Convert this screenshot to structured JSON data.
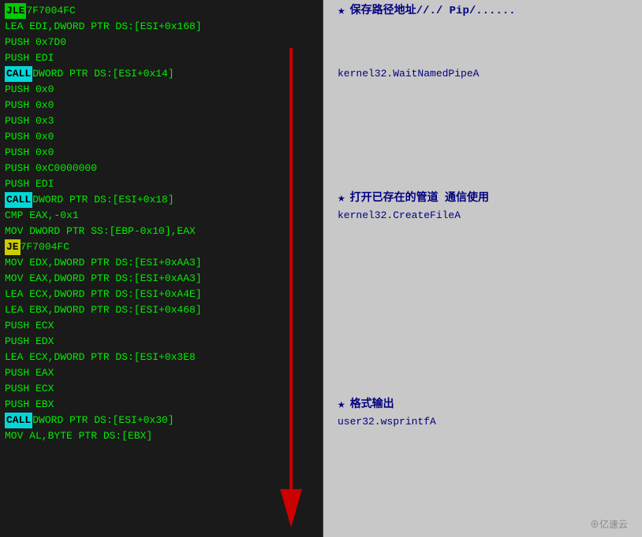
{
  "left_panel": {
    "lines": [
      {
        "parts": [
          {
            "text": "JLE ",
            "style": "jle-bg"
          },
          {
            "text": "7F7004FC",
            "style": "default"
          }
        ]
      },
      {
        "parts": [
          {
            "text": "LEA EDI,DWORD PTR DS:[ESI+0x168]",
            "style": "default"
          }
        ]
      },
      {
        "parts": [
          {
            "text": "PUSH 0x7D0",
            "style": "default"
          }
        ]
      },
      {
        "parts": [
          {
            "text": "PUSH EDI",
            "style": "default"
          }
        ]
      },
      {
        "parts": [
          {
            "text": "CALL ",
            "style": "call-bg"
          },
          {
            "text": "DWORD PTR DS:[ESI+0x14]",
            "style": "default"
          }
        ]
      },
      {
        "parts": [
          {
            "text": "PUSH 0x0",
            "style": "default"
          }
        ]
      },
      {
        "parts": [
          {
            "text": "PUSH 0x0",
            "style": "default"
          }
        ]
      },
      {
        "parts": [
          {
            "text": "PUSH 0x3",
            "style": "default"
          }
        ]
      },
      {
        "parts": [
          {
            "text": "PUSH 0x0",
            "style": "default"
          }
        ]
      },
      {
        "parts": [
          {
            "text": "PUSH 0x0",
            "style": "default"
          }
        ]
      },
      {
        "parts": [
          {
            "text": "PUSH 0xC0000000",
            "style": "default"
          }
        ]
      },
      {
        "parts": [
          {
            "text": "PUSH EDI",
            "style": "default"
          }
        ]
      },
      {
        "parts": [
          {
            "text": "CALL ",
            "style": "call-bg"
          },
          {
            "text": "DWORD PTR DS:[ESI+0x18]",
            "style": "default"
          }
        ]
      },
      {
        "parts": [
          {
            "text": "CMP EAX,-0x1",
            "style": "default"
          }
        ]
      },
      {
        "parts": [
          {
            "text": "MOV DWORD PTR SS:[EBP-0x10],EAX",
            "style": "default"
          }
        ]
      },
      {
        "parts": [
          {
            "text": "JE ",
            "style": "je-bg"
          },
          {
            "text": "7F7004FC",
            "style": "default"
          }
        ]
      },
      {
        "parts": [
          {
            "text": "MOV EDX,DWORD PTR DS:[ESI+0xAA3",
            "style": "default"
          },
          {
            "text": "]",
            "style": "default"
          }
        ]
      },
      {
        "parts": [
          {
            "text": "MOV EAX,DWORD PTR DS:[ESI+0xAA3",
            "style": "default"
          },
          {
            "text": "]",
            "style": "default"
          }
        ]
      },
      {
        "parts": [
          {
            "text": "LEA ECX,DWORD PTR DS:[ESI+0xA4E",
            "style": "default"
          },
          {
            "text": "]",
            "style": "default"
          }
        ]
      },
      {
        "parts": [
          {
            "text": "LEA EBX,DWORD PTR DS:[ESI+0x468",
            "style": "default"
          },
          {
            "text": "]",
            "style": "default"
          }
        ]
      },
      {
        "parts": [
          {
            "text": "PUSH ECX",
            "style": "default"
          }
        ]
      },
      {
        "parts": [
          {
            "text": "PUSH EDX",
            "style": "default"
          }
        ]
      },
      {
        "parts": [
          {
            "text": "LEA ECX,DWORD PTR DS:[ESI+0x3E8",
            "style": "default"
          }
        ]
      },
      {
        "parts": [
          {
            "text": "PUSH EAX",
            "style": "default"
          }
        ]
      },
      {
        "parts": [
          {
            "text": "PUSH ECX",
            "style": "default"
          }
        ]
      },
      {
        "parts": [
          {
            "text": "PUSH EBX",
            "style": "default"
          }
        ]
      },
      {
        "parts": [
          {
            "text": "CALL ",
            "style": "call-bg"
          },
          {
            "text": "DWORD PTR DS:[ESI+0x30]",
            "style": "default"
          }
        ]
      },
      {
        "parts": [
          {
            "text": "MOV AL,BYTE PTR DS:[EBX]",
            "style": "default"
          }
        ]
      }
    ]
  },
  "right_panel": {
    "annotations": [
      {
        "top_line": 0,
        "star": true,
        "text": "保存路径地址//./ Pip/......",
        "api": null
      },
      {
        "top_line": 4,
        "star": false,
        "text": null,
        "api": "kernel32.WaitNamedPipeA"
      },
      {
        "top_line": 12,
        "star": true,
        "text": "打开已存在的管道 通信使用",
        "api": "kernel32.CreateFileA"
      },
      {
        "top_line": 26,
        "star": true,
        "text": "格式输出",
        "api": "user32.wsprintfA"
      }
    ]
  },
  "watermark": "⊕亿速云"
}
